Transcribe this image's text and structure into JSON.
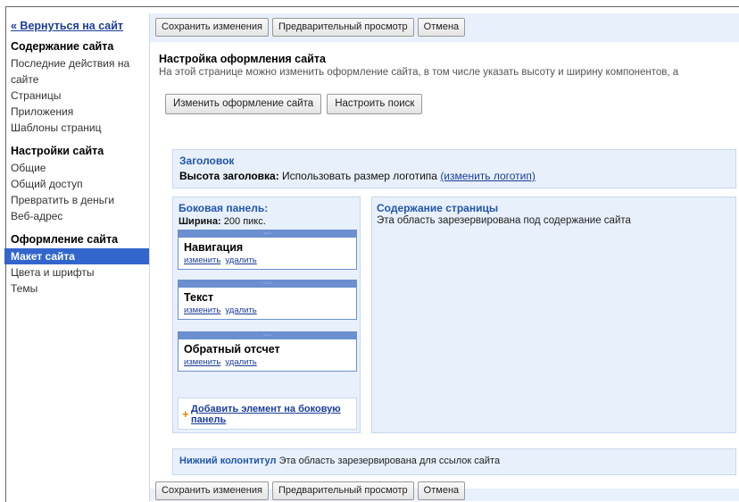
{
  "sidebar": {
    "back_link": "« Вернуться на сайт",
    "sections": [
      {
        "title": "Содержание сайта",
        "items": [
          "Последние действия на сайте",
          "Страницы",
          "Приложения",
          "Шаблоны страниц"
        ]
      },
      {
        "title": "Настройки сайта",
        "items": [
          "Общие",
          "Общий доступ",
          "Превратить в деньги",
          "Веб-адрес"
        ]
      },
      {
        "title": "Оформление сайта",
        "items": [
          "Макет сайта",
          "Цвета и шрифты",
          "Темы"
        ]
      }
    ],
    "active_item": "Макет сайта"
  },
  "toolbar": {
    "save": "Сохранить изменения",
    "preview": "Предварительный просмотр",
    "cancel": "Отмена"
  },
  "page": {
    "title": "Настройка оформления сайта",
    "description": "На этой странице можно изменить оформление сайта, в том числе указать высоту и ширину компонентов, а",
    "change_layout_button": "Изменить оформление сайта",
    "search_settings_button": "Настроить поиск"
  },
  "header_area": {
    "label": "Заголовок",
    "height_label": "Высота заголовка:",
    "height_value": "Использовать размер логотипа",
    "change_logo_link": "(изменить логотип)"
  },
  "side_panel": {
    "label": "Боковая панель:",
    "width_label": "Ширина:",
    "width_value": "200 пикс.",
    "widgets": [
      {
        "title": "Навигация",
        "edit": "изменить",
        "delete": "удалить"
      },
      {
        "title": "Текст",
        "edit": "изменить",
        "delete": "удалить"
      },
      {
        "title": "Обратный отсчет",
        "edit": "изменить",
        "delete": "удалить"
      }
    ],
    "add_widget_link": "Добавить элемент на боковую панель"
  },
  "content_area": {
    "label": "Содержание страницы",
    "description": "Эта область зарезервирована под содержание сайта"
  },
  "footer_area": {
    "label": "Нижний колонтитул",
    "description": "Эта область зарезервирована для ссылок сайта"
  },
  "colors": {
    "accent": "#3366cc",
    "link": "#1a3d99",
    "panel_bg": "#e8f0fb",
    "label_blue": "#2255aa"
  }
}
